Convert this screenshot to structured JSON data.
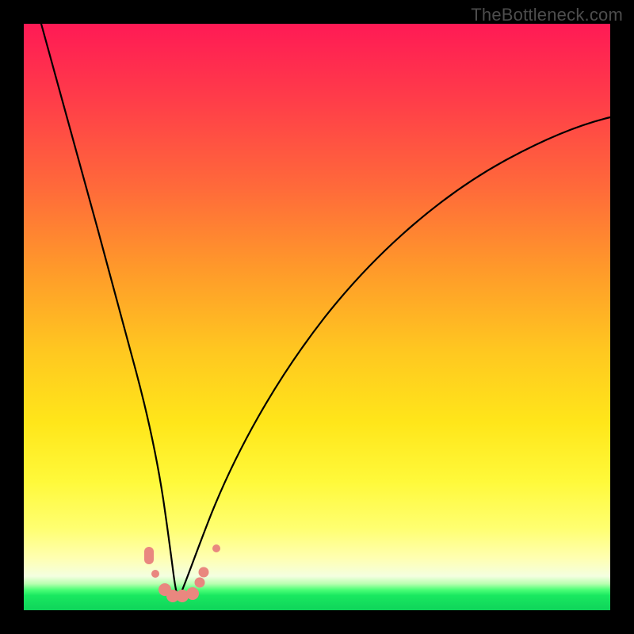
{
  "watermark": "TheBottleneck.com",
  "colors": {
    "frame": "#000000",
    "marker": "#e9877f",
    "curve": "#000000"
  },
  "chart_data": {
    "type": "line",
    "title": "",
    "xlabel": "",
    "ylabel": "",
    "xlim": [
      0,
      100
    ],
    "ylim": [
      0,
      100
    ],
    "note": "Two curves descending to a shared minimum near x≈26, then the right curve rises again. Background gradient encodes red (high) → green (low). Values are estimated from pixel positions; no axis ticks are visible.",
    "series": [
      {
        "name": "left-curve",
        "x": [
          3,
          6,
          9,
          12,
          15,
          17,
          19,
          20.5,
          22,
          23,
          24,
          25,
          26
        ],
        "y": [
          100,
          88,
          74,
          60,
          45,
          34,
          24,
          16.5,
          10,
          6.5,
          4,
          2.5,
          2
        ]
      },
      {
        "name": "right-curve",
        "x": [
          26,
          28,
          30,
          33,
          37,
          42,
          48,
          55,
          63,
          72,
          81,
          90,
          100
        ],
        "y": [
          2,
          4,
          8,
          14,
          22,
          31,
          40,
          49,
          58,
          66,
          73,
          79,
          84
        ]
      }
    ],
    "markers": [
      {
        "x": 21.2,
        "y": 9.0,
        "size": "md"
      },
      {
        "x": 21.8,
        "y": 7.2,
        "size": "md"
      },
      {
        "x": 22.5,
        "y": 5.2,
        "size": "sm"
      },
      {
        "x": 24.0,
        "y": 2.8,
        "size": "lg"
      },
      {
        "x": 25.3,
        "y": 2.2,
        "size": "lg"
      },
      {
        "x": 27.0,
        "y": 2.2,
        "size": "lg"
      },
      {
        "x": 28.8,
        "y": 2.6,
        "size": "lg"
      },
      {
        "x": 30.0,
        "y": 4.5,
        "size": "md"
      },
      {
        "x": 30.7,
        "y": 6.2,
        "size": "md"
      },
      {
        "x": 32.8,
        "y": 10.2,
        "size": "sm"
      }
    ]
  }
}
